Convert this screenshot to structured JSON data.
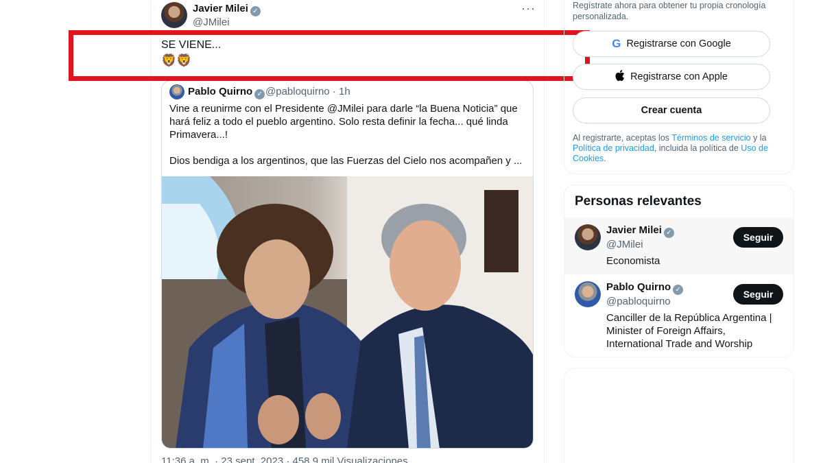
{
  "tweet": {
    "author_name": "Javier Milei",
    "author_handle": "@JMilei",
    "more_label": "···",
    "text": "SE VIENE...",
    "emoji": "🦁🦁",
    "quote": {
      "author_name": "Pablo Quirno",
      "author_handle": "@pabloquirno",
      "time": "· 1h",
      "paragraph1": "Vine a reunirme con el Presidente @JMilei para darle “la Buena Noticia” que hará feliz a todo el pueblo argentino. Solo resta definir la fecha... qué linda Primavera...!",
      "paragraph2": "Dios bendiga a los argentinos, que las Fuerzas del  Cielo nos acompañen y ..."
    },
    "footer_partial": "11:36 a. m. · 23 sept. 2023 · 458,9 mil Visualizaciones"
  },
  "sidebar": {
    "signup_subtitle": "Regístrate ahora para obtener tu propia cronología personalizada.",
    "google_label": "Registrarse con Google",
    "apple_label": "Registrarse con Apple",
    "create_label": "Crear cuenta",
    "legal_prefix": "Al registrarte, aceptas los ",
    "terms_link": "Términos de servicio",
    "legal_and": " y la ",
    "privacy_link": "Política de privacidad",
    "legal_mid": ", incluida la política de ",
    "cookies_link": "Uso de Cookies",
    "legal_end": ".",
    "people_title": "Personas relevantes",
    "people": [
      {
        "name": "Javier Milei",
        "handle": "@JMilei",
        "bio": "Economista",
        "follow_label": "Seguir"
      },
      {
        "name": "Pablo Quirno",
        "handle": "@pabloquirno",
        "bio": "Canciller de la República Argentina | Minister of Foreign Affairs, International Trade and Worship",
        "follow_label": "Seguir"
      }
    ]
  },
  "icons": {
    "verified": "verified-badge-icon",
    "google": "google-icon",
    "apple": "apple-icon",
    "more": "more-options-icon"
  }
}
